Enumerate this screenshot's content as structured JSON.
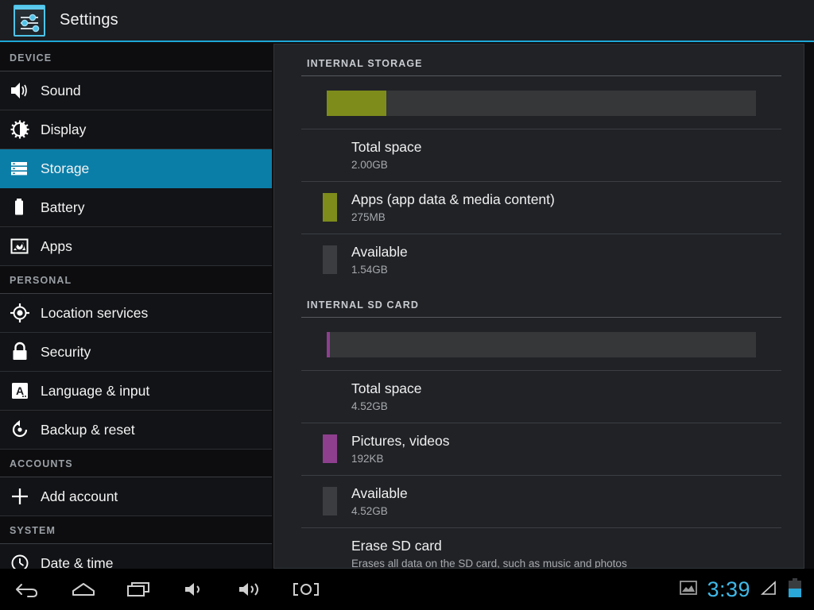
{
  "titlebar": {
    "app_title": "Settings",
    "icon": "settings-sliders-icon"
  },
  "sidebar": {
    "sections": [
      {
        "header": "DEVICE",
        "items": [
          {
            "label": "Sound",
            "icon": "speaker-icon",
            "selected": false
          },
          {
            "label": "Display",
            "icon": "brightness-icon",
            "selected": false
          },
          {
            "label": "Storage",
            "icon": "storage-icon",
            "selected": true
          },
          {
            "label": "Battery",
            "icon": "battery-icon",
            "selected": false
          },
          {
            "label": "Apps",
            "icon": "apps-image-icon",
            "selected": false
          }
        ]
      },
      {
        "header": "PERSONAL",
        "items": [
          {
            "label": "Location services",
            "icon": "location-crosshair-icon",
            "selected": false
          },
          {
            "label": "Security",
            "icon": "lock-icon",
            "selected": false
          },
          {
            "label": "Language & input",
            "icon": "language-a-icon",
            "selected": false
          },
          {
            "label": "Backup & reset",
            "icon": "backup-restore-icon",
            "selected": false
          }
        ]
      },
      {
        "header": "ACCOUNTS",
        "items": [
          {
            "label": "Add account",
            "icon": "plus-icon",
            "selected": false
          }
        ]
      },
      {
        "header": "SYSTEM",
        "items": [
          {
            "label": "Date & time",
            "icon": "clock-icon",
            "selected": false
          }
        ]
      }
    ]
  },
  "content": {
    "groups": [
      {
        "header": "INTERNAL STORAGE",
        "bar": {
          "used_color": "#7d8c1b",
          "track_color": "#353739",
          "segments": [
            {
              "name": "Apps (app data & media content)",
              "color": "#7d8c1b",
              "percent": 13.8
            }
          ]
        },
        "rows": [
          {
            "title": "Total space",
            "value": "2.00GB",
            "swatch": null
          },
          {
            "title": "Apps (app data & media content)",
            "value": "275MB",
            "swatch": "#7d8c1b"
          },
          {
            "title": "Available",
            "value": "1.54GB",
            "swatch": "#3b3d40"
          }
        ]
      },
      {
        "header": "INTERNAL SD CARD",
        "bar": {
          "used_color": "#8e3f8e",
          "track_color": "#353739",
          "segments": [
            {
              "name": "Pictures, videos",
              "color": "#8e3f8e",
              "percent": 0.8
            }
          ]
        },
        "rows": [
          {
            "title": "Total space",
            "value": "4.52GB",
            "swatch": null
          },
          {
            "title": "Pictures, videos",
            "value": "192KB",
            "swatch": "#8e3f8e"
          },
          {
            "title": "Available",
            "value": "4.52GB",
            "swatch": "#3b3d40"
          },
          {
            "title": "Erase SD card",
            "value": "Erases all data on the SD card, such as music and photos",
            "swatch": null
          }
        ]
      }
    ]
  },
  "navbar": {
    "buttons": [
      {
        "name": "back-icon"
      },
      {
        "name": "home-icon"
      },
      {
        "name": "recents-icon"
      },
      {
        "name": "volume-down-icon"
      },
      {
        "name": "volume-up-icon"
      },
      {
        "name": "screenshot-icon"
      }
    ],
    "status": {
      "image_icon": "image-icon",
      "time": "3:39",
      "signal_icon": "signal-triangle-icon",
      "battery_icon": "battery-icon",
      "clock_color": "#3fb9e8"
    }
  }
}
